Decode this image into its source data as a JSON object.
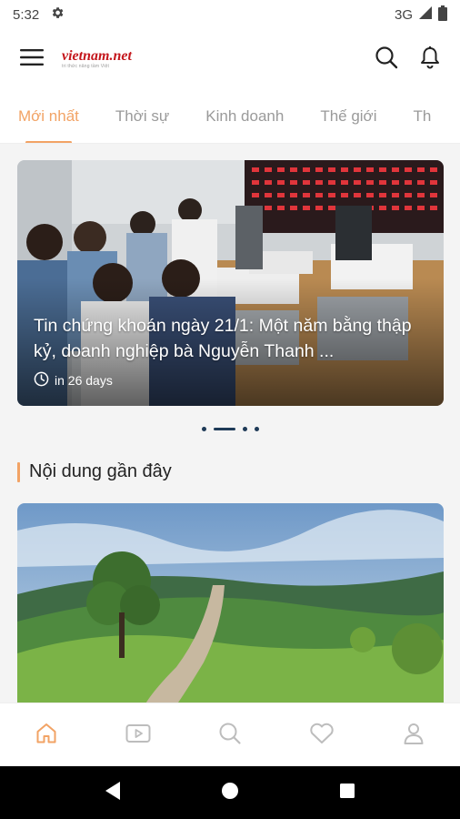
{
  "status_bar": {
    "time": "5:32",
    "network": "3G"
  },
  "header": {
    "logo_text": "vietnam.net",
    "logo_tagline": "tri thức nâng tầm Việt",
    "icons": {
      "menu": "hamburger-menu-icon",
      "search": "search-icon",
      "notifications": "bell-icon"
    }
  },
  "tabs": [
    {
      "label": "Mới nhất",
      "active": true
    },
    {
      "label": "Thời sự"
    },
    {
      "label": "Kinh doanh"
    },
    {
      "label": "Thế giới"
    },
    {
      "label": "Th"
    }
  ],
  "hero": {
    "title": "Tin chứng khoán ngày 21/1: Một năm bằng thập kỷ, doanh nghiệp bà Nguyễn Thanh ...",
    "time": "in 26 days",
    "carousel": {
      "count": 4,
      "active_index": 1
    }
  },
  "section": {
    "title": "Nội dung gần đây"
  },
  "bottom_nav": [
    {
      "name": "home",
      "icon": "home-icon",
      "active": true
    },
    {
      "name": "video",
      "icon": "video-play-icon"
    },
    {
      "name": "search",
      "icon": "search-icon"
    },
    {
      "name": "favorites",
      "icon": "heart-icon"
    },
    {
      "name": "profile",
      "icon": "user-icon"
    }
  ],
  "colors": {
    "accent": "#f2a365",
    "inactive": "#9a9a9a",
    "nav_icon": "#bdbdbd",
    "dot": "#1e3a57"
  }
}
